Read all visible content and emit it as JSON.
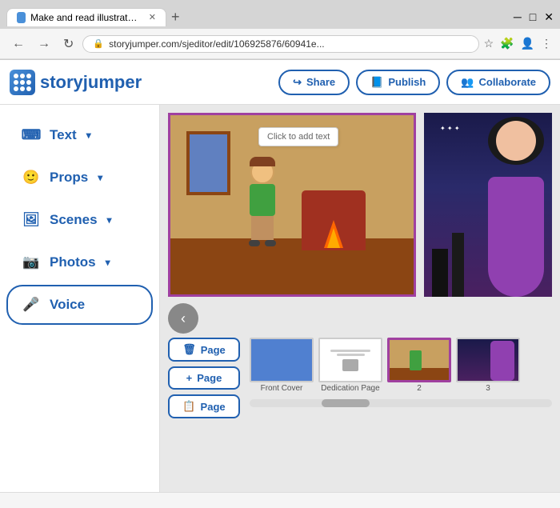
{
  "browser": {
    "tab_title": "Make and read illustrated story b",
    "address": "storyjumper.com/sjeditor/edit/106925876/60941e...",
    "new_tab_label": "+"
  },
  "header": {
    "logo_text": "storyjumper",
    "share_label": "Share",
    "publish_label": "Publish",
    "collaborate_label": "Collaborate"
  },
  "sidebar": {
    "items": [
      {
        "id": "text",
        "label": "Text",
        "icon": "keyboard"
      },
      {
        "id": "props",
        "label": "Props",
        "icon": "smiley"
      },
      {
        "id": "scenes",
        "label": "Scenes",
        "icon": "image"
      },
      {
        "id": "photos",
        "label": "Photos",
        "icon": "camera"
      },
      {
        "id": "voice",
        "label": "Voice",
        "icon": "microphone"
      }
    ]
  },
  "canvas": {
    "text_bubble": "Click to add text",
    "nav_arrow": "‹"
  },
  "page_controls": [
    {
      "id": "delete-page",
      "label": "Page",
      "icon": "🗑"
    },
    {
      "id": "add-page",
      "label": "Page",
      "icon": "+"
    },
    {
      "id": "copy-page",
      "label": "Page",
      "icon": "📋"
    }
  ],
  "thumbnails": [
    {
      "id": "front-cover",
      "label": "Front Cover",
      "type": "blue"
    },
    {
      "id": "dedication",
      "label": "Dedication Page",
      "type": "white"
    },
    {
      "id": "page2",
      "label": "2",
      "type": "scene",
      "active": true
    },
    {
      "id": "page3",
      "label": "3",
      "type": "side"
    }
  ]
}
